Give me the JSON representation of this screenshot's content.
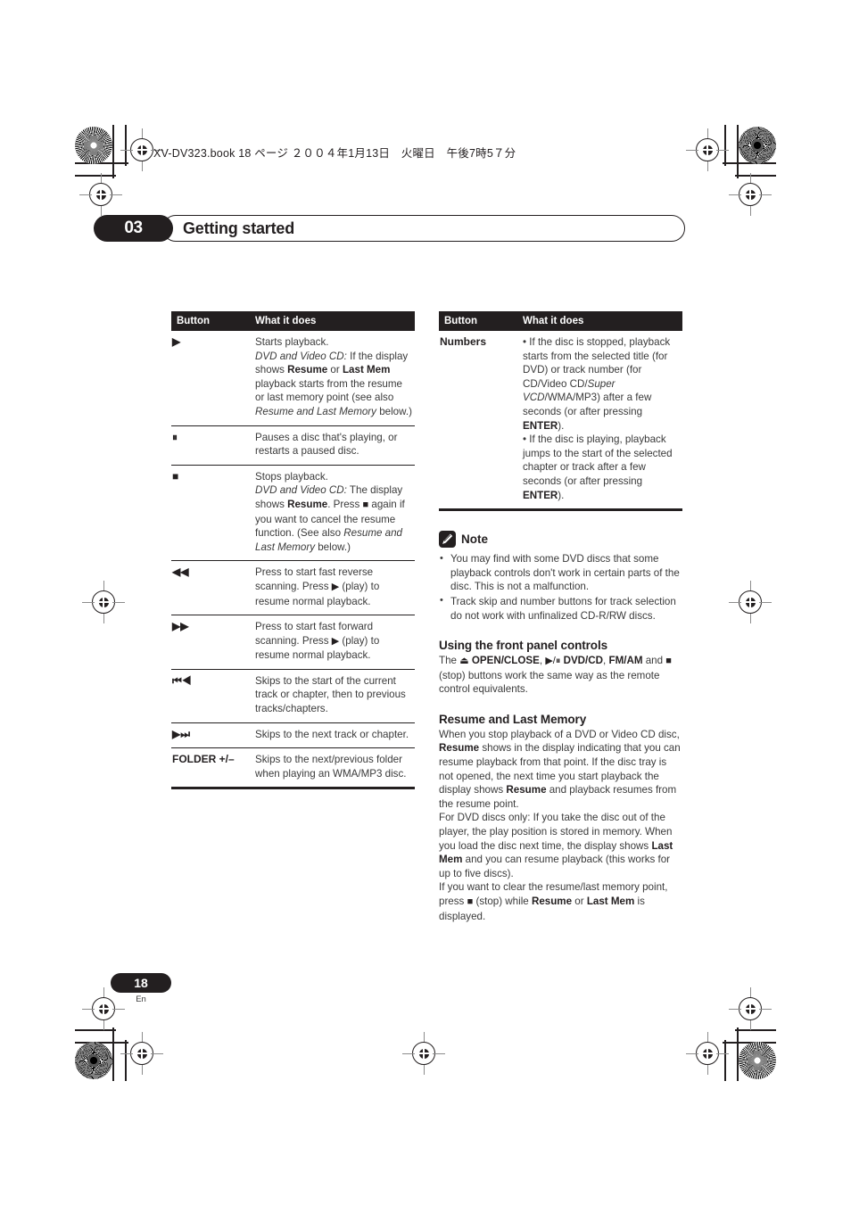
{
  "print_slug": "XV-DV323.book 18 ページ ２００４年1月13日　火曜日　午後7時5７分",
  "chapter": {
    "number": "03",
    "title": "Getting started"
  },
  "footer": {
    "page_number": "18",
    "language_code": "En"
  },
  "left_column": {
    "table": {
      "headers": [
        "Button",
        "What it does"
      ],
      "rows": [
        {
          "button_symbol": "▶",
          "description_html": "Starts playback.<br><i>DVD and Video CD:</i> If the display shows <b>Resume</b> or <b>Last Mem</b> playback starts from the resume or last memory point (see also <i>Resume and Last Memory</i> below.)"
        },
        {
          "button_symbol": "⏸",
          "description_html": "Pauses a disc that's playing, or restarts a paused disc."
        },
        {
          "button_symbol": "■",
          "description_html": "Stops playback.<br><i>DVD and Video CD:</i> The display shows <b>Resume</b>. Press <span class=\"sym\">■</span> again if you want to cancel the resume function. (See also <i>Resume and Last Memory</i> below.)"
        },
        {
          "button_symbol": "◀◀",
          "description_html": "Press to start fast reverse scanning. Press <span class=\"sym\">▶</span> (play) to resume normal playback."
        },
        {
          "button_symbol": "▶▶",
          "description_html": "Press to start fast forward scanning. Press <span class=\"sym\">▶</span> (play) to resume normal playback."
        },
        {
          "button_symbol": "⏮◀",
          "description_html": "Skips to the start of the current track or chapter, then to previous tracks/chapters."
        },
        {
          "button_symbol": "▶⏭",
          "description_html": "Skips to the next track or chapter."
        },
        {
          "button_symbol": "FOLDER +/–",
          "description_html": "Skips to the next/previous folder when playing an WMA/MP3 disc."
        }
      ]
    }
  },
  "right_column": {
    "table": {
      "headers": [
        "Button",
        "What it does"
      ],
      "rows": [
        {
          "button_symbol": "Numbers",
          "description_html": "• If the disc is stopped, playback starts from the selected title (for DVD) or track number (for CD/Video CD/<i>Super VCD</i>/WMA/MP3) after a few seconds (or after pressing <b>ENTER</b>).<br>• If the disc is playing, playback jumps to the start of the selected chapter or track after a few seconds (or after pressing <b>ENTER</b>)."
        }
      ]
    },
    "note": {
      "icon": "pencil-icon",
      "title": "Note",
      "bullets": [
        "You may find with some DVD discs that some playback controls don't work in certain parts of the disc. This is not a malfunction.",
        "Track skip and number buttons for track selection do not work with unfinalized CD-R/RW discs."
      ]
    },
    "sections": [
      {
        "heading": "Using the front panel controls",
        "body_html": "The <span class=\"sym\">⏏</span> <b>OPEN/CLOSE</b>, <span class=\"sym\">▶/⏸</span> <b>DVD/CD</b>, <b>FM/AM</b> and <span class=\"sym\">■</span> (stop) buttons work the same way as the remote control equivalents."
      },
      {
        "heading": "Resume and Last Memory",
        "body_html": "When you stop playback of a DVD or Video CD disc, <b>Resume</b> shows in the display indicating that you can resume playback from that point. If the disc tray is not opened, the next time you start playback the display shows <b>Resume</b> and playback resumes from the resume point.<br>For DVD discs only: If you take the disc out of the player, the play position is stored in memory. When you load the disc next time, the display shows <b>Last Mem</b> and you can resume playback (this works for up to five discs).<br>If you want to clear the resume/last memory point, press <span class=\"sym\">■</span> (stop) while <b>Resume</b> or <b>Last Mem</b> is displayed."
      }
    ]
  }
}
